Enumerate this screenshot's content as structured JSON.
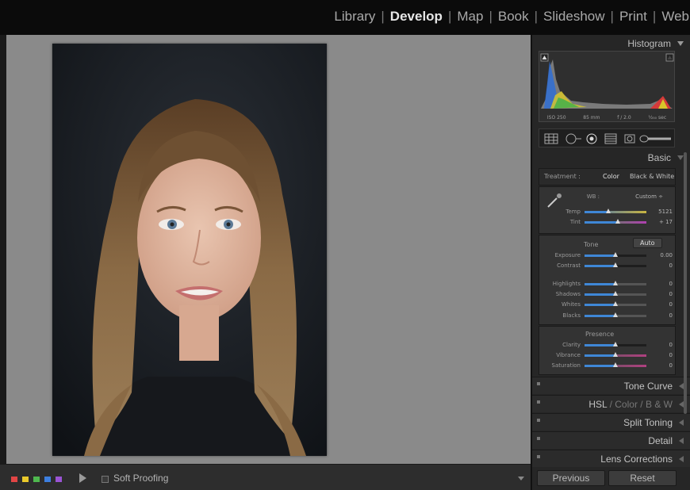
{
  "modules": [
    "Library",
    "Develop",
    "Map",
    "Book",
    "Slideshow",
    "Print",
    "Web"
  ],
  "active_module": "Develop",
  "module_separator": "|",
  "toolbar": {
    "color_swatches": [
      "#e14545",
      "#e9c92b",
      "#4fb84f",
      "#3d7fe0",
      "#9a54d4"
    ],
    "soft_proofing_label": "Soft Proofing"
  },
  "histogram": {
    "title": "Histogram",
    "iso": "ISO 250",
    "focal": "85 mm",
    "aperture": "f / 2.0",
    "shutter": "¹⁄₂₅₀ sec"
  },
  "basic": {
    "title": "Basic",
    "treatment_label": "Treatment :",
    "color_label": "Color",
    "bw_label": "Black & White",
    "wb_label": "WB :",
    "wb_value": "Custom ÷",
    "temp": {
      "label": "Temp",
      "value": "5121"
    },
    "tint": {
      "label": "Tint",
      "value": "+ 17"
    },
    "tone_label": "Tone",
    "auto_label": "Auto",
    "exposure": {
      "label": "Exposure",
      "value": "0.00"
    },
    "contrast": {
      "label": "Contrast",
      "value": "0"
    },
    "highlights": {
      "label": "Highlights",
      "value": "0"
    },
    "shadows": {
      "label": "Shadows",
      "value": "0"
    },
    "whites": {
      "label": "Whites",
      "value": "0"
    },
    "blacks": {
      "label": "Blacks",
      "value": "0"
    },
    "presence_label": "Presence",
    "clarity": {
      "label": "Clarity",
      "value": "0"
    },
    "vibrance": {
      "label": "Vibrance",
      "value": "0"
    },
    "saturation": {
      "label": "Saturation",
      "value": "0"
    }
  },
  "panels": {
    "tone_curve": "Tone Curve",
    "hsl": "HSL",
    "color": "Color",
    "bw": "B & W",
    "hsl_sep": "/",
    "split_toning": "Split Toning",
    "detail": "Detail",
    "lens_corrections": "Lens Corrections"
  },
  "buttons": {
    "previous": "Previous",
    "reset": "Reset"
  }
}
